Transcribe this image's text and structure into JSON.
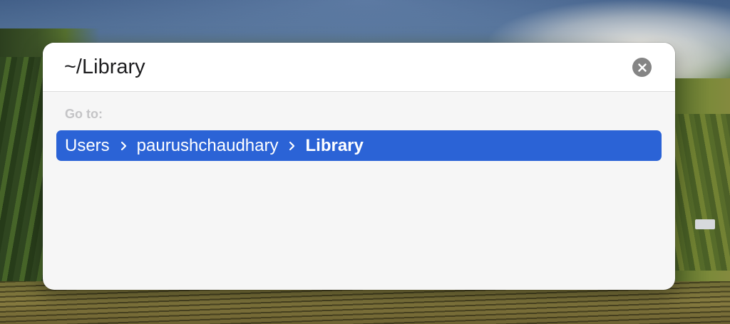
{
  "go_to_folder": {
    "path_value": "~/Library",
    "goto_label": "Go to:",
    "suggestion": {
      "crumbs": [
        "Users",
        "paurushchaudhary",
        "Library"
      ],
      "separator_icon": "chevron-right-icon"
    },
    "clear_icon": "close-circle-icon"
  },
  "colors": {
    "selection": "#2b63d6",
    "panel_bg": "#f6f6f6",
    "header_bg": "#ffffff",
    "label_gray": "#c4c4c6",
    "clear_button": "#858585"
  }
}
